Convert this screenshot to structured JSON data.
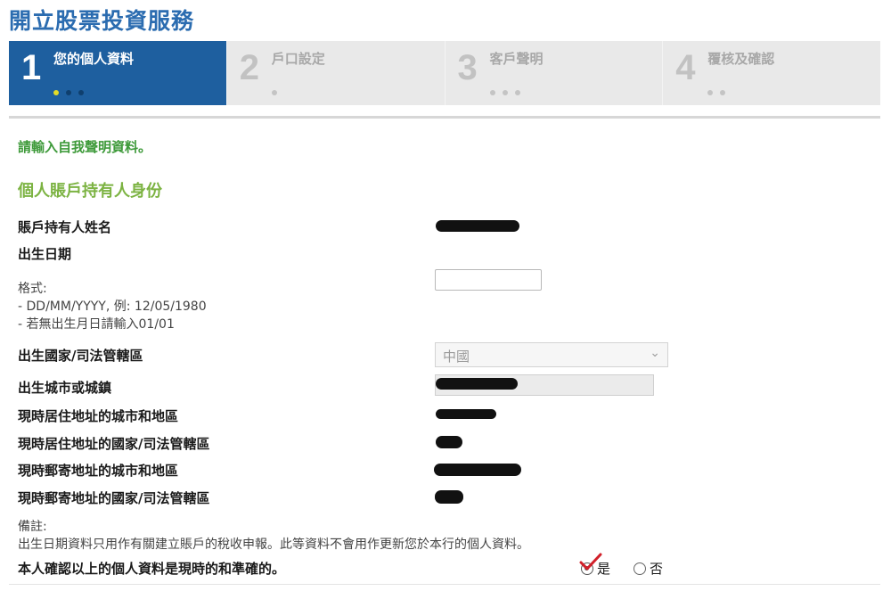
{
  "page_title": "開立股票投資服務",
  "steps": [
    {
      "num": "1",
      "label": "您的個人資料",
      "dots": 3,
      "active": true
    },
    {
      "num": "2",
      "label": "戶口設定",
      "dots": 1,
      "active": false
    },
    {
      "num": "3",
      "label": "客戶聲明",
      "dots": 3,
      "active": false
    },
    {
      "num": "4",
      "label": "覆核及確認",
      "dots": 2,
      "active": false
    }
  ],
  "intro": "請輸入自我聲明資料。",
  "section_title": "個人賬戶持有人身份",
  "fields": {
    "holder_name_label": "賬戶持有人姓名",
    "dob_label": "出生日期",
    "dob_format_1": "格式:",
    "dob_format_2": "- DD/MM/YYYY, 例: 12/05/1980",
    "dob_format_3": "- 若無出生月日請輸入01/01",
    "dob_value": "",
    "birth_country_label": "出生國家/司法管轄區",
    "birth_country_value": "中國",
    "birth_city_label": "出生城市或城鎮",
    "res_city_label": "現時居住地址的城市和地區",
    "res_country_label": "現時居住地址的國家/司法管轄區",
    "mail_city_label": "現時郵寄地址的城市和地區",
    "mail_country_label": "現時郵寄地址的國家/司法管轄區"
  },
  "note_head": "備註:",
  "note_body": "出生日期資料只用作有關建立賬戶的稅收申報。此等資料不會用作更新您於本行的個人資料。",
  "confirm_label": "本人確認以上的個人資料是現時的和準確的。",
  "confirm_yes": "是",
  "confirm_no": "否",
  "colors": {
    "title": "#2b6cb0",
    "active_step": "#1e5f9f",
    "intro_green": "#3e9a3a",
    "section_green": "#7cb342",
    "check_red": "#d1202a"
  }
}
